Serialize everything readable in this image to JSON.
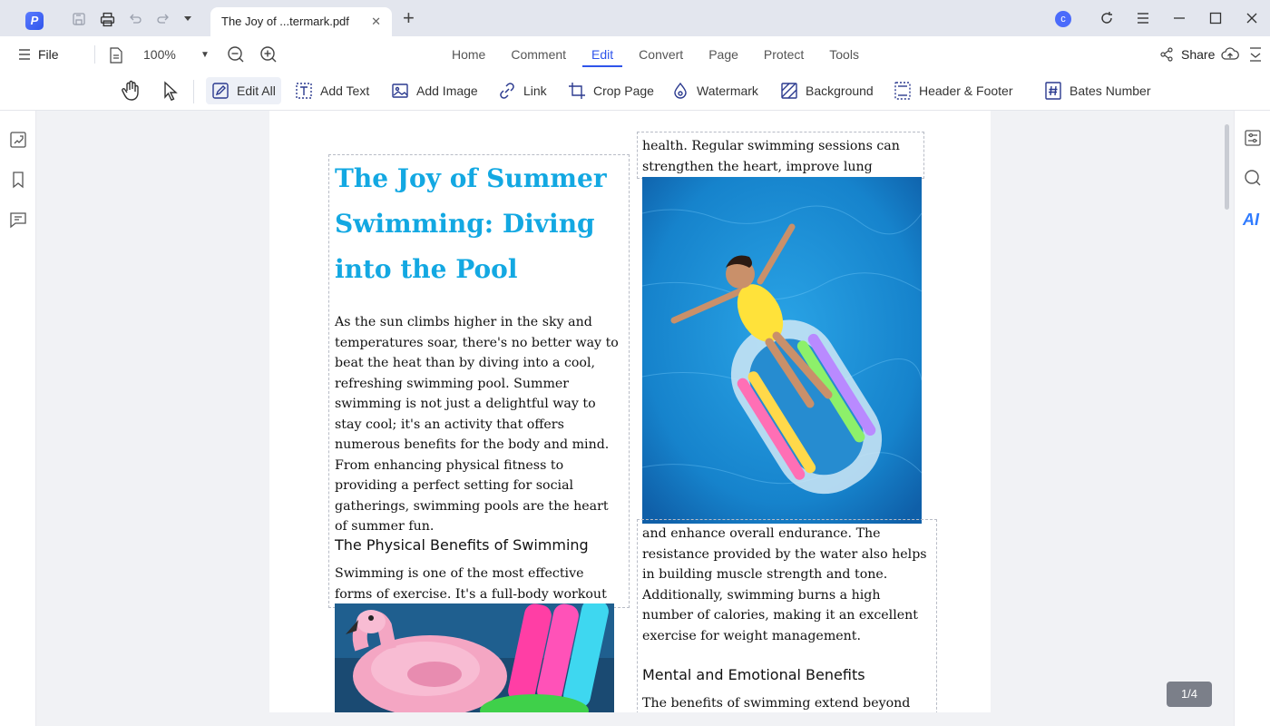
{
  "titlebar": {
    "tab_title": "The Joy of ...termark.pdf",
    "avatar_letter": "c"
  },
  "menubar": {
    "file_label": "File",
    "zoom_value": "100%",
    "tabs": [
      {
        "label": "Home"
      },
      {
        "label": "Comment"
      },
      {
        "label": "Edit"
      },
      {
        "label": "Convert"
      },
      {
        "label": "Page"
      },
      {
        "label": "Protect"
      },
      {
        "label": "Tools"
      }
    ],
    "active_tab": "Edit",
    "share_label": "Share"
  },
  "toolbar": {
    "tools": [
      {
        "label": "Edit All"
      },
      {
        "label": "Add Text"
      },
      {
        "label": "Add Image"
      },
      {
        "label": "Link"
      },
      {
        "label": "Crop Page"
      },
      {
        "label": "Watermark"
      },
      {
        "label": "Background"
      },
      {
        "label": "Header & Footer"
      },
      {
        "label": "Bates Number"
      }
    ]
  },
  "right_panel": {
    "ai_label": "AI"
  },
  "document": {
    "title": "The Joy of Summer Swimming: Diving into the Pool",
    "intro": "As the sun climbs higher in the sky and temperatures soar, there's no better way to beat the heat than by diving into a cool, refreshing swimming pool. Summer swimming is not just a delightful way to stay cool; it's an activity that offers numerous benefits for the body and mind. From enhancing physical fitness to providing a perfect setting for social gatherings, swimming pools are the heart of summer fun.",
    "section1_heading": "The Physical Benefits of Swimming",
    "section1_text": "Swimming is one of the most effective forms of exercise. It's a full-body workout that",
    "col2_top": "health. Regular swimming sessions can strengthen the heart, improve lung capacity,",
    "col2_mid": "and enhance overall endurance. The resistance provided by the water also helps in building muscle strength and tone. Additionally, swimming burns a high number of calories, making it an excellent exercise for weight management.",
    "section2_heading": "Mental and Emotional Benefits",
    "section2_text": "The benefits of swimming extend beyond the"
  },
  "page_indicator": "1/4",
  "colors": {
    "accent": "#2f54eb",
    "title_blue": "#13a8e2",
    "pool_blue": "#1a8fd6"
  }
}
